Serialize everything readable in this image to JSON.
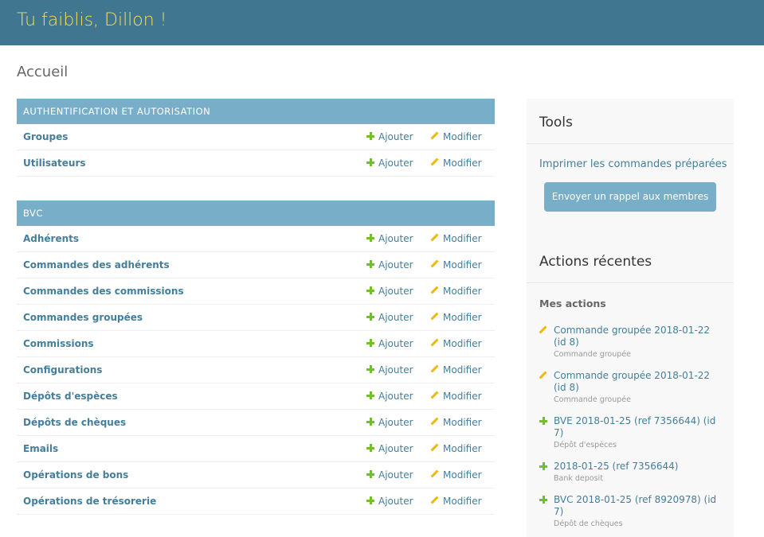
{
  "header": {
    "title": "Tu faiblis, Dillon !"
  },
  "breadcrumb": "Accueil",
  "modules": [
    {
      "caption": "AUTHENTIFICATION ET AUTORISATION",
      "rows": [
        {
          "name": "Groupes",
          "add": "Ajouter",
          "change": "Modifier"
        },
        {
          "name": "Utilisateurs",
          "add": "Ajouter",
          "change": "Modifier"
        }
      ]
    },
    {
      "caption": "BVC",
      "rows": [
        {
          "name": "Adhérents",
          "add": "Ajouter",
          "change": "Modifier"
        },
        {
          "name": "Commandes des adhérents",
          "add": "Ajouter",
          "change": "Modifier"
        },
        {
          "name": "Commandes des commissions",
          "add": "Ajouter",
          "change": "Modifier"
        },
        {
          "name": "Commandes groupées",
          "add": "Ajouter",
          "change": "Modifier"
        },
        {
          "name": "Commissions",
          "add": "Ajouter",
          "change": "Modifier"
        },
        {
          "name": "Configurations",
          "add": "Ajouter",
          "change": "Modifier"
        },
        {
          "name": "Dépôts d'espèces",
          "add": "Ajouter",
          "change": "Modifier"
        },
        {
          "name": "Dépôts de chèques",
          "add": "Ajouter",
          "change": "Modifier"
        },
        {
          "name": "Emails",
          "add": "Ajouter",
          "change": "Modifier"
        },
        {
          "name": "Opérations de bons",
          "add": "Ajouter",
          "change": "Modifier"
        },
        {
          "name": "Opérations de trésorerie",
          "add": "Ajouter",
          "change": "Modifier"
        }
      ]
    }
  ],
  "sidebar": {
    "tools_title": "Tools",
    "print_link": "Imprimer les commandes préparées",
    "reminder_button": "Envoyer un rappel aux membres",
    "recent_title": "Actions récentes",
    "my_actions": "Mes actions",
    "actions": [
      {
        "icon": "pencil-icon",
        "text": "Commande groupée 2018-01-22 (id 8)",
        "type": "Commande groupée"
      },
      {
        "icon": "pencil-icon",
        "text": "Commande groupée 2018-01-22 (id 8)",
        "type": "Commande groupée"
      },
      {
        "icon": "plus-icon",
        "text": "BVE 2018-01-25 (ref 7356644) (id 7)",
        "type": "Dépôt d'espèces"
      },
      {
        "icon": "plus-icon",
        "text": "2018-01-25 (ref 7356644)",
        "type": "Bank deposit"
      },
      {
        "icon": "plus-icon",
        "text": "BVC 2018-01-25 (ref 8920978) (id 7)",
        "type": "Dépôt de chèques"
      }
    ]
  },
  "colors": {
    "header_bg": "#417690",
    "title": "#f5dd5d",
    "module_caption_bg": "#79aec8",
    "link": "#447e9b",
    "add_icon": "#70bf2b",
    "change_icon": "#efb80b"
  }
}
